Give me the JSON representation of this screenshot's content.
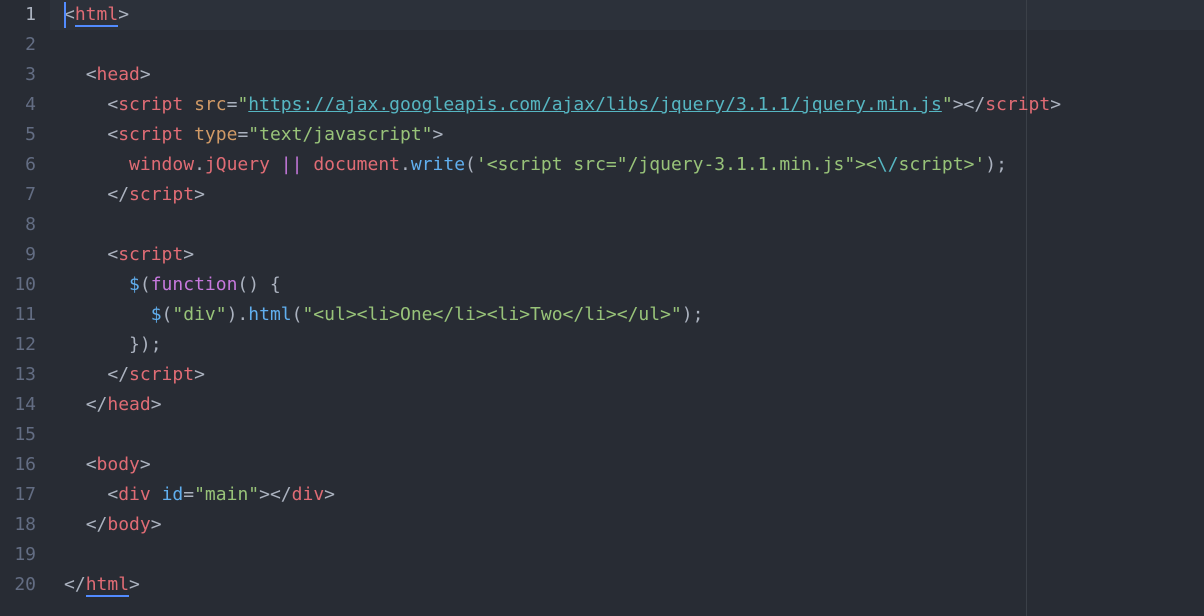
{
  "editor": {
    "theme_colors": {
      "background": "#282c34",
      "gutter_text": "#636d83",
      "tag": "#e06c75",
      "attribute": "#d19a66",
      "string": "#98c379",
      "function": "#61afef",
      "keyword": "#c678dd",
      "cursor": "#528bff"
    },
    "line_numbers": [
      "1",
      "2",
      "3",
      "4",
      "5",
      "6",
      "7",
      "8",
      "9",
      "10",
      "11",
      "12",
      "13",
      "14",
      "15",
      "16",
      "17",
      "18",
      "19",
      "20"
    ],
    "active_line": 1,
    "lines": {
      "l1": {
        "open": "<",
        "tag": "html",
        "close": ">"
      },
      "l3": {
        "indent": "  ",
        "open": "<",
        "tag": "head",
        "close": ">"
      },
      "l4": {
        "indent": "    ",
        "open": "<",
        "tag": "script",
        "sp": " ",
        "attr": "src",
        "eq": "=",
        "q1": "\"",
        "url": "https://ajax.googleapis.com/ajax/libs/jquery/3.1.1/jquery.min.js",
        "q2": "\"",
        "gt": "></",
        "tag2": "script",
        "close": ">"
      },
      "l5": {
        "indent": "    ",
        "open": "<",
        "tag": "script",
        "sp": " ",
        "attr": "type",
        "eq": "=",
        "val": "\"text/javascript\"",
        "close": ">"
      },
      "l6": {
        "indent": "      ",
        "obj1": "window",
        "dot1": ".",
        "prop1": "jQuery",
        "sp1": " ",
        "op": "||",
        "sp2": " ",
        "obj2": "document",
        "dot2": ".",
        "method": "write",
        "paren1": "(",
        "str1": "'<script src=\"/jquery-3.1.1.min.js\"><",
        "esc": "\\/",
        "str2": "script>'",
        "paren2": ");"
      },
      "l7": {
        "indent": "    ",
        "open": "</",
        "tag": "script",
        "close": ">"
      },
      "l9": {
        "indent": "    ",
        "open": "<",
        "tag": "script",
        "close": ">"
      },
      "l10": {
        "indent": "      ",
        "dollar": "$",
        "paren": "(",
        "kw": "function",
        "rest": "() {"
      },
      "l11": {
        "indent": "        ",
        "dollar": "$",
        "paren1": "(",
        "sel": "\"div\"",
        "paren2": ").",
        "method": "html",
        "paren3": "(",
        "str": "\"<ul><li>One</li><li>Two</li></ul>\"",
        "end": ");"
      },
      "l12": {
        "indent": "      ",
        "text": "});"
      },
      "l13": {
        "indent": "    ",
        "open": "</",
        "tag": "script",
        "close": ">"
      },
      "l14": {
        "indent": "  ",
        "open": "</",
        "tag": "head",
        "close": ">"
      },
      "l16": {
        "indent": "  ",
        "open": "<",
        "tag": "body",
        "close": ">"
      },
      "l17": {
        "indent": "    ",
        "open": "<",
        "tag": "div",
        "sp": " ",
        "attr": "id",
        "eq": "=",
        "val": "\"main\"",
        "gt": "></",
        "tag2": "div",
        "close": ">"
      },
      "l18": {
        "indent": "  ",
        "open": "</",
        "tag": "body",
        "close": ">"
      },
      "l20": {
        "open": "</",
        "tag": "html",
        "close": ">"
      }
    }
  }
}
